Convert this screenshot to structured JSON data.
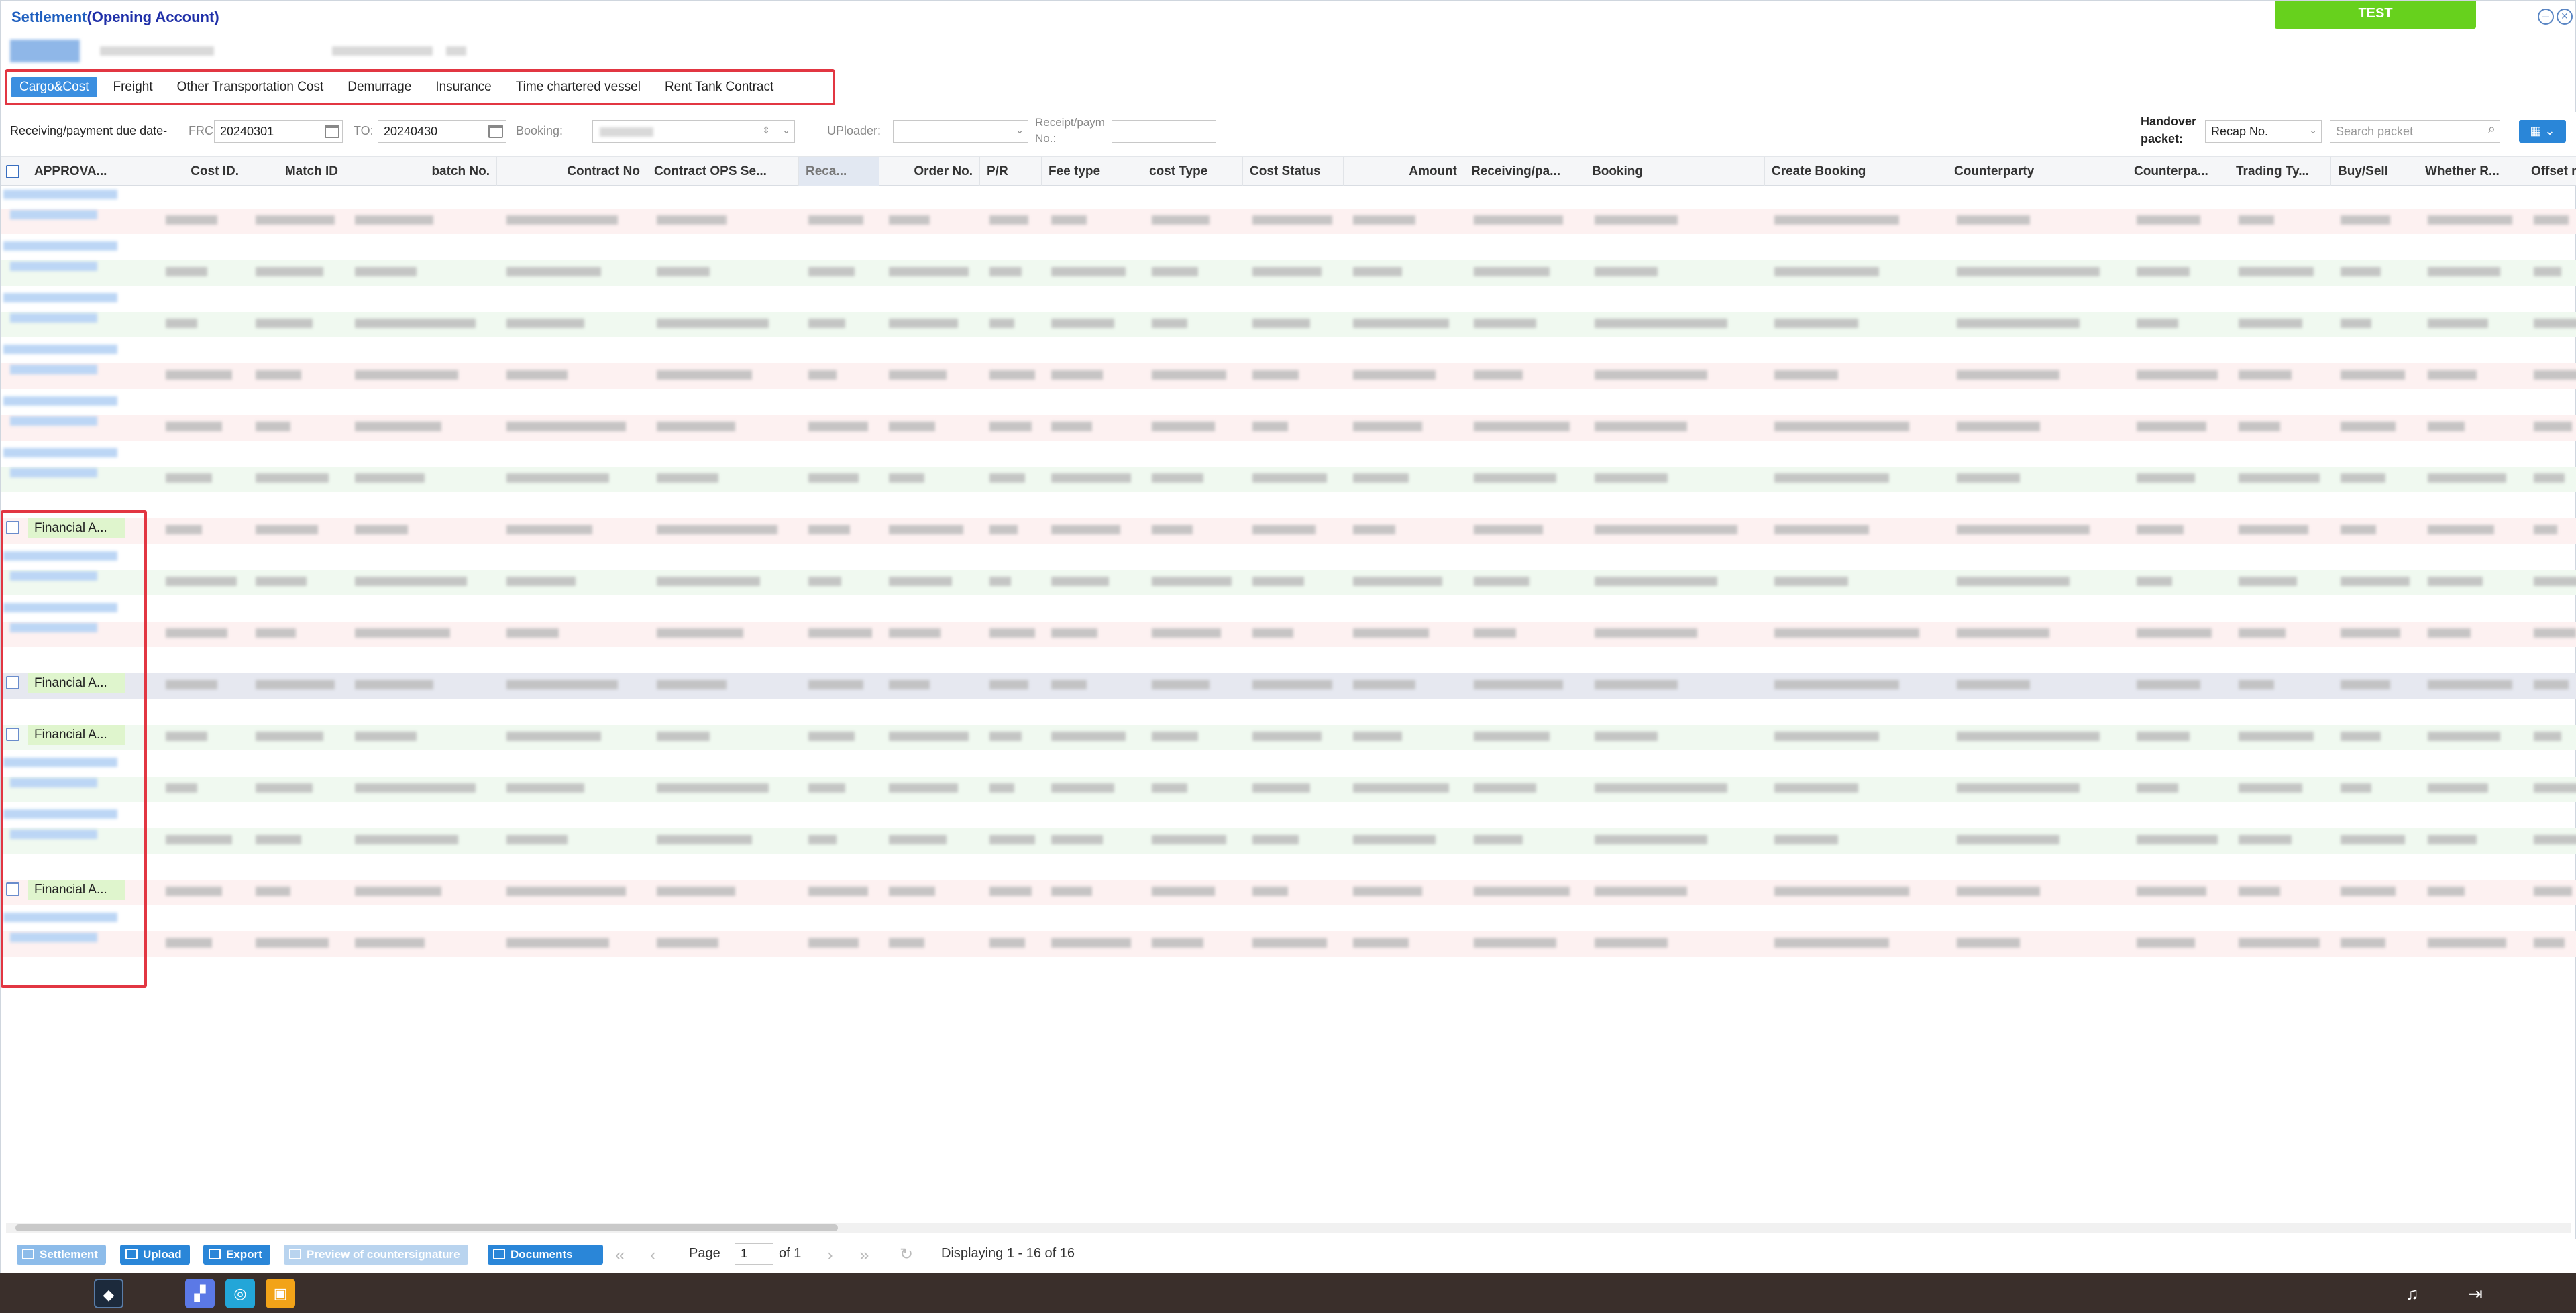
{
  "window": {
    "title_main": "Settlement",
    "title_sub": "(Opening Account)",
    "env_badge": "TEST",
    "minimize_glyph": "–",
    "close_glyph": "×"
  },
  "tabs": [
    {
      "label": "Cargo&Cost",
      "active": true
    },
    {
      "label": "Freight",
      "active": false
    },
    {
      "label": "Other Transportation Cost",
      "active": false
    },
    {
      "label": "Demurrage",
      "active": false
    },
    {
      "label": "Insurance",
      "active": false
    },
    {
      "label": "Time chartered vessel",
      "active": false
    },
    {
      "label": "Rent Tank Contract",
      "active": false
    }
  ],
  "filters": {
    "due_date_label": "Receiving/payment due date-",
    "from_label": "FRC",
    "from_value": "20240301",
    "to_label": "TO:",
    "to_value": "20240430",
    "booking_label": "Booking:",
    "uploader_label": "UPloader:",
    "receipt_label_1": "Receipt/paym",
    "receipt_label_2": "No.:",
    "handover_label_1": "Handover",
    "handover_label_2": "packet:",
    "handover_value": "Recap No.",
    "search_placeholder": "Search packet"
  },
  "columns": [
    {
      "label": "APPROVA...",
      "align": "left"
    },
    {
      "label": "Cost ID.",
      "align": "right"
    },
    {
      "label": "Match ID",
      "align": "right"
    },
    {
      "label": "batch No.",
      "align": "right"
    },
    {
      "label": "Contract No",
      "align": "right"
    },
    {
      "label": "Contract OPS Se...",
      "align": "left"
    },
    {
      "label": "Reca...",
      "align": "left",
      "sorted": true
    },
    {
      "label": "Order No.",
      "align": "right"
    },
    {
      "label": "P/R",
      "align": "left"
    },
    {
      "label": "Fee type",
      "align": "left"
    },
    {
      "label": "cost Type",
      "align": "left"
    },
    {
      "label": "Cost Status",
      "align": "left"
    },
    {
      "label": "Amount",
      "align": "right"
    },
    {
      "label": "Receiving/pa...",
      "align": "left"
    },
    {
      "label": "Booking",
      "align": "left"
    },
    {
      "label": "Create Booking",
      "align": "left"
    },
    {
      "label": "Counterparty",
      "align": "left"
    },
    {
      "label": "Counterpa...",
      "align": "left"
    },
    {
      "label": "Trading Ty...",
      "align": "left"
    },
    {
      "label": "Buy/Sell",
      "align": "left"
    },
    {
      "label": "Whether R...",
      "align": "left"
    },
    {
      "label": "Offset r",
      "align": "left"
    }
  ],
  "rows": [
    {
      "tint": "#fdf1f1",
      "approval": ""
    },
    {
      "tint": "#f0f9f0",
      "approval": ""
    },
    {
      "tint": "#f0f9f0",
      "approval": ""
    },
    {
      "tint": "#fdf1f1",
      "approval": ""
    },
    {
      "tint": "#fdf1f1",
      "approval": ""
    },
    {
      "tint": "#f0f9f0",
      "approval": ""
    },
    {
      "tint": "#fdf1f1",
      "approval": "Financial A..."
    },
    {
      "tint": "#f0f9f0",
      "approval": ""
    },
    {
      "tint": "#fdf1f1",
      "approval": ""
    },
    {
      "tint": "#e6e8f0",
      "approval": "Financial A..."
    },
    {
      "tint": "#f0f9f0",
      "approval": "Financial A..."
    },
    {
      "tint": "#f0f9f0",
      "approval": ""
    },
    {
      "tint": "#f0f9f0",
      "approval": ""
    },
    {
      "tint": "#fdf1f1",
      "approval": "Financial A..."
    },
    {
      "tint": "#fdf1f1",
      "approval": ""
    }
  ],
  "toolbar": {
    "settlement": "Settlement",
    "upload": "Upload",
    "export": "Export",
    "preview": "Preview of countersignature",
    "documents": "Documents"
  },
  "pager": {
    "page_label": "Page",
    "page_value": "1",
    "of_label": "of 1",
    "display_text": "Displaying 1 - 16 of 16"
  },
  "colors": {
    "accent": "#3b8fe0",
    "title": "#1f5fbf",
    "env_badge": "#67d11d",
    "highlight_box": "#e23642",
    "approval_bg": "#dff5cd"
  }
}
